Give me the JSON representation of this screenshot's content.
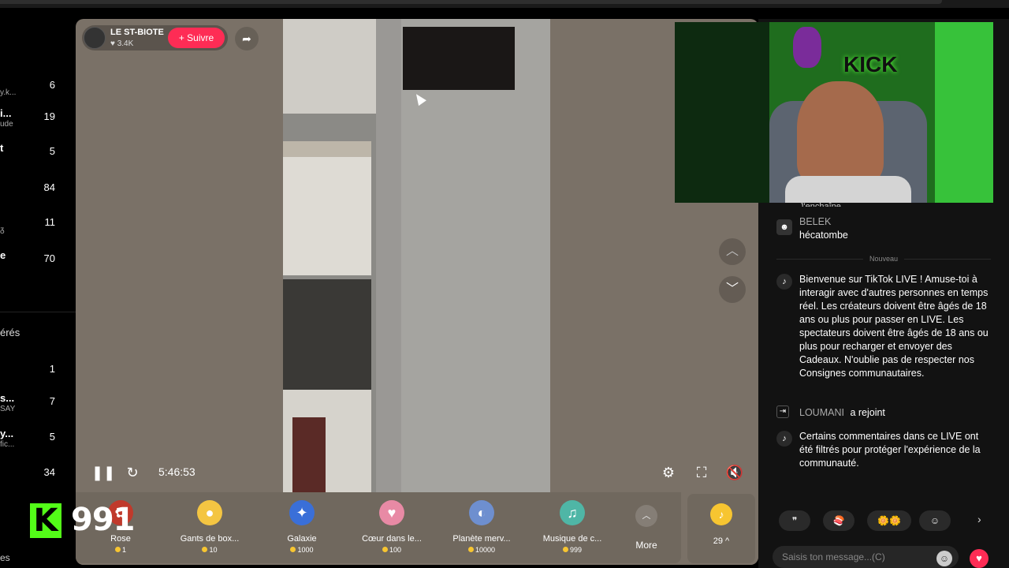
{
  "sidebar": {
    "items": [
      {
        "name": "",
        "sub": "y.k...",
        "count": "6"
      },
      {
        "name": "i...",
        "sub": "ude",
        "count": "19"
      },
      {
        "name": "t",
        "sub": "",
        "count": "5"
      },
      {
        "name": "",
        "sub": "",
        "count": "84"
      },
      {
        "name": "",
        "sub": "ᵹ",
        "count": "11"
      },
      {
        "name": "e",
        "sub": "",
        "count": "70"
      }
    ],
    "section_header": "érés",
    "section_items": [
      {
        "name": "",
        "sub": "",
        "count": "1"
      },
      {
        "name": "s...",
        "sub": "SAY",
        "count": "7"
      },
      {
        "name": "y...",
        "sub": "fic...",
        "count": "5"
      },
      {
        "name": "",
        "sub": "",
        "count": "34"
      }
    ],
    "footer": "es"
  },
  "host": {
    "name": "LE ST-BIOTE",
    "likes": "♥ 3.4K",
    "follow_label": "+ Suivre"
  },
  "player": {
    "time": "5:46:53"
  },
  "gifts": [
    {
      "name": "Rose",
      "price": "1",
      "icon": "rose-icon",
      "color": "#c0392b"
    },
    {
      "name": "Gants de box...",
      "price": "10",
      "icon": "boxing-gloves-icon",
      "color": "#f4c542"
    },
    {
      "name": "Galaxie",
      "price": "1000",
      "icon": "galaxy-icon",
      "color": "#3a6fd8"
    },
    {
      "name": "Cœur dans le...",
      "price": "100",
      "icon": "heart-hands-icon",
      "color": "#e88aa5"
    },
    {
      "name": "Planète merv...",
      "price": "10000",
      "icon": "planet-icon",
      "color": "#6e8fcf"
    },
    {
      "name": "Musique de c...",
      "price": "999",
      "icon": "music-icon",
      "color": "#4fb6a6"
    }
  ],
  "more_label": "More",
  "coins": {
    "value": "29 ^"
  },
  "overlay": {
    "count": "991",
    "badge": "K"
  },
  "chat": {
    "partial_top": "J'enchaîne",
    "messages": [
      {
        "user": "BELEK",
        "text": "hécatombe"
      },
      {
        "system": "Bienvenue sur TikTok LIVE ! Amuse-toi à interagir avec d'autres personnes en temps réel. Les créateurs doivent être âgés de 18 ans ou plus pour passer en LIVE. Les spectateurs doivent être âgés de 18 ans ou plus pour recharger et envoyer des Cadeaux. N'oublie pas de respecter nos Consignes communautaires."
      },
      {
        "join_user": "LOUMANI",
        "join_text": "a rejoint"
      },
      {
        "system": "Certains commentaires dans ce LIVE ont été filtrés pour protéger l'expérience de la communauté."
      }
    ],
    "new_divider": "Nouveau",
    "quick_replies": [
      "❞",
      "🍣",
      "🌼🌼",
      "☺"
    ],
    "input_placeholder": "Saisis ton message...(C)"
  }
}
